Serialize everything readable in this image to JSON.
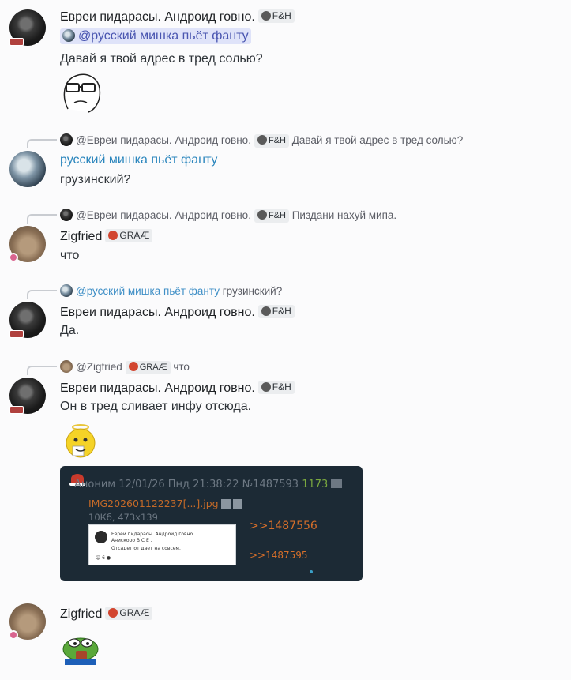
{
  "users": {
    "evrei": {
      "name": "Евреи пидарасы. Андроид говно.",
      "tag": "F&H",
      "tag_icon": "skull-icon"
    },
    "mishka": {
      "name": "русский мишка пьёт фанту"
    },
    "zigfried": {
      "name": "Zigfried",
      "tag": "GRAÆ",
      "tag_icon": "mushroom-icon"
    }
  },
  "messages": [
    {
      "author": "Евреи пидарасы. Андроид говно.",
      "tag": "F&H",
      "mention": "@русский мишка пьёт фанту",
      "text": "Давай я твой адрес в тред солью?"
    },
    {
      "reply": {
        "author": "@Евреи пидарасы. Андроид говно.",
        "tag": "F&H",
        "text": "Давай я твой адрес в тред солью?"
      },
      "author": "русский мишка пьёт фанту",
      "text": "грузинский?"
    },
    {
      "reply": {
        "author": "@Евреи пидарасы. Андроид говно.",
        "tag": "F&H",
        "text": "Пиздани нахуй мипа."
      },
      "author": "Zigfried",
      "tag": "GRAÆ",
      "text": "что"
    },
    {
      "reply": {
        "author": "@русский мишка пьёт фанту",
        "text": "грузинский?"
      },
      "author": "Евреи пидарасы. Андроид говно.",
      "tag": "F&H",
      "text": "Да."
    },
    {
      "reply": {
        "author": "@Zigfried",
        "tag": "GRAÆ",
        "text": "что"
      },
      "author": "Евреи пидарасы. Андроид говно.",
      "tag": "F&H",
      "text": "Он в тред сливает инфу отсюда."
    },
    {
      "author": "Zigfried",
      "tag": "GRAÆ"
    }
  ],
  "embed": {
    "header_prefix": "Аноним 12/01/26 Пнд 21:38:22 №1487593",
    "header_count": "1173",
    "filename": "IMG202601122237[...].jpg",
    "filemeta": "10Кб, 473x139",
    "link1": ">>1487556",
    "link2": ">>1487595",
    "inner_name": "Евреи пидарасы. Андроид говно.",
    "inner_line1": "Анискоро В С Е .",
    "inner_line2": "Отсадет от дает на совсем.",
    "inner_count": "6"
  },
  "colors": {
    "background": "#fbfbfc",
    "mention_bg": "#dfe3f9",
    "mention_text": "#4955b0",
    "name_blue": "#2b86bd",
    "embed_bg": "#1c2a35",
    "embed_link": "#d46e2a"
  }
}
